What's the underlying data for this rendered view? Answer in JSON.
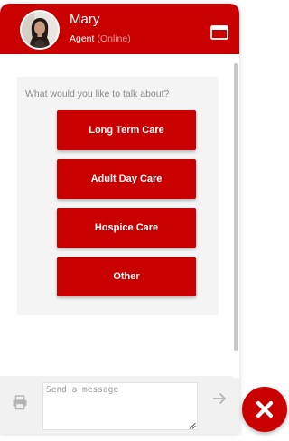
{
  "header": {
    "agent_name": "Mary",
    "agent_role": "Agent",
    "agent_status": "(Online)"
  },
  "menu": {
    "prompt": "What would you like to talk about?",
    "options": [
      {
        "label": "Long Term Care"
      },
      {
        "label": "Adult Day Care"
      },
      {
        "label": "Hospice Care"
      },
      {
        "label": "Other"
      }
    ]
  },
  "composer": {
    "placeholder": "Send a message"
  },
  "icons": {
    "minimize": "window-minimize-icon",
    "print": "print-icon",
    "send": "arrow-right-icon",
    "close": "close-icon"
  },
  "colors": {
    "brand": "#c80000",
    "footer_bg": "#f1f1f1",
    "card_bg": "#f4f4f4"
  }
}
